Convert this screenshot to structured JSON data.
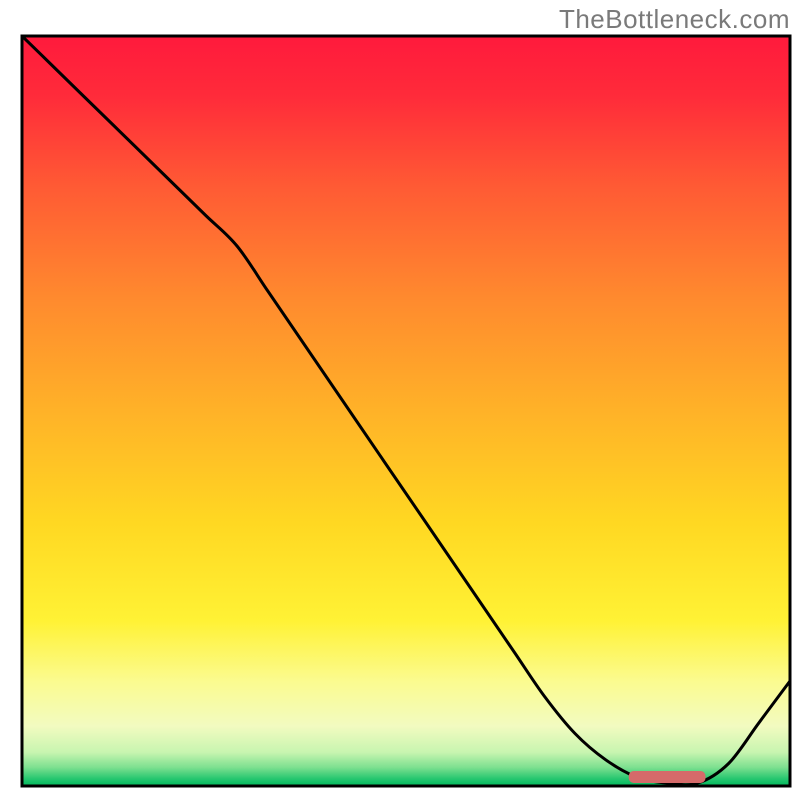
{
  "watermark": "TheBottleneck.com",
  "chart_data": {
    "type": "line",
    "title": "",
    "xlabel": "",
    "ylabel": "",
    "xlim": [
      0,
      100
    ],
    "ylim": [
      0,
      100
    ],
    "x": [
      0,
      4,
      8,
      12,
      16,
      20,
      24,
      28,
      32,
      36,
      40,
      44,
      48,
      52,
      56,
      60,
      64,
      68,
      72,
      76,
      80,
      84,
      88,
      92,
      96,
      100
    ],
    "values": [
      100,
      96,
      92,
      88,
      84,
      80,
      76,
      72,
      66,
      60,
      54,
      48,
      42,
      36,
      30,
      24,
      18,
      12,
      7,
      3.5,
      1.2,
      0.4,
      0.4,
      3,
      8.5,
      14
    ],
    "minimum_bar": {
      "x_start": 79,
      "x_end": 89,
      "y": 1.2
    },
    "background": {
      "type": "vertical-gradient",
      "stops": [
        {
          "pos": 0.0,
          "color": "#ff1a3c"
        },
        {
          "pos": 0.08,
          "color": "#ff2b3a"
        },
        {
          "pos": 0.2,
          "color": "#ff5a34"
        },
        {
          "pos": 0.35,
          "color": "#ff8a2e"
        },
        {
          "pos": 0.5,
          "color": "#ffb228"
        },
        {
          "pos": 0.65,
          "color": "#ffd822"
        },
        {
          "pos": 0.78,
          "color": "#fff235"
        },
        {
          "pos": 0.86,
          "color": "#fbfb8f"
        },
        {
          "pos": 0.92,
          "color": "#f2fbc0"
        },
        {
          "pos": 0.955,
          "color": "#c8f5b0"
        },
        {
          "pos": 0.975,
          "color": "#7ee090"
        },
        {
          "pos": 0.99,
          "color": "#28c770"
        },
        {
          "pos": 1.0,
          "color": "#00b85c"
        }
      ]
    },
    "line_color": "#000000",
    "min_bar_color": "#d56a6a",
    "border_color": "#000000"
  }
}
